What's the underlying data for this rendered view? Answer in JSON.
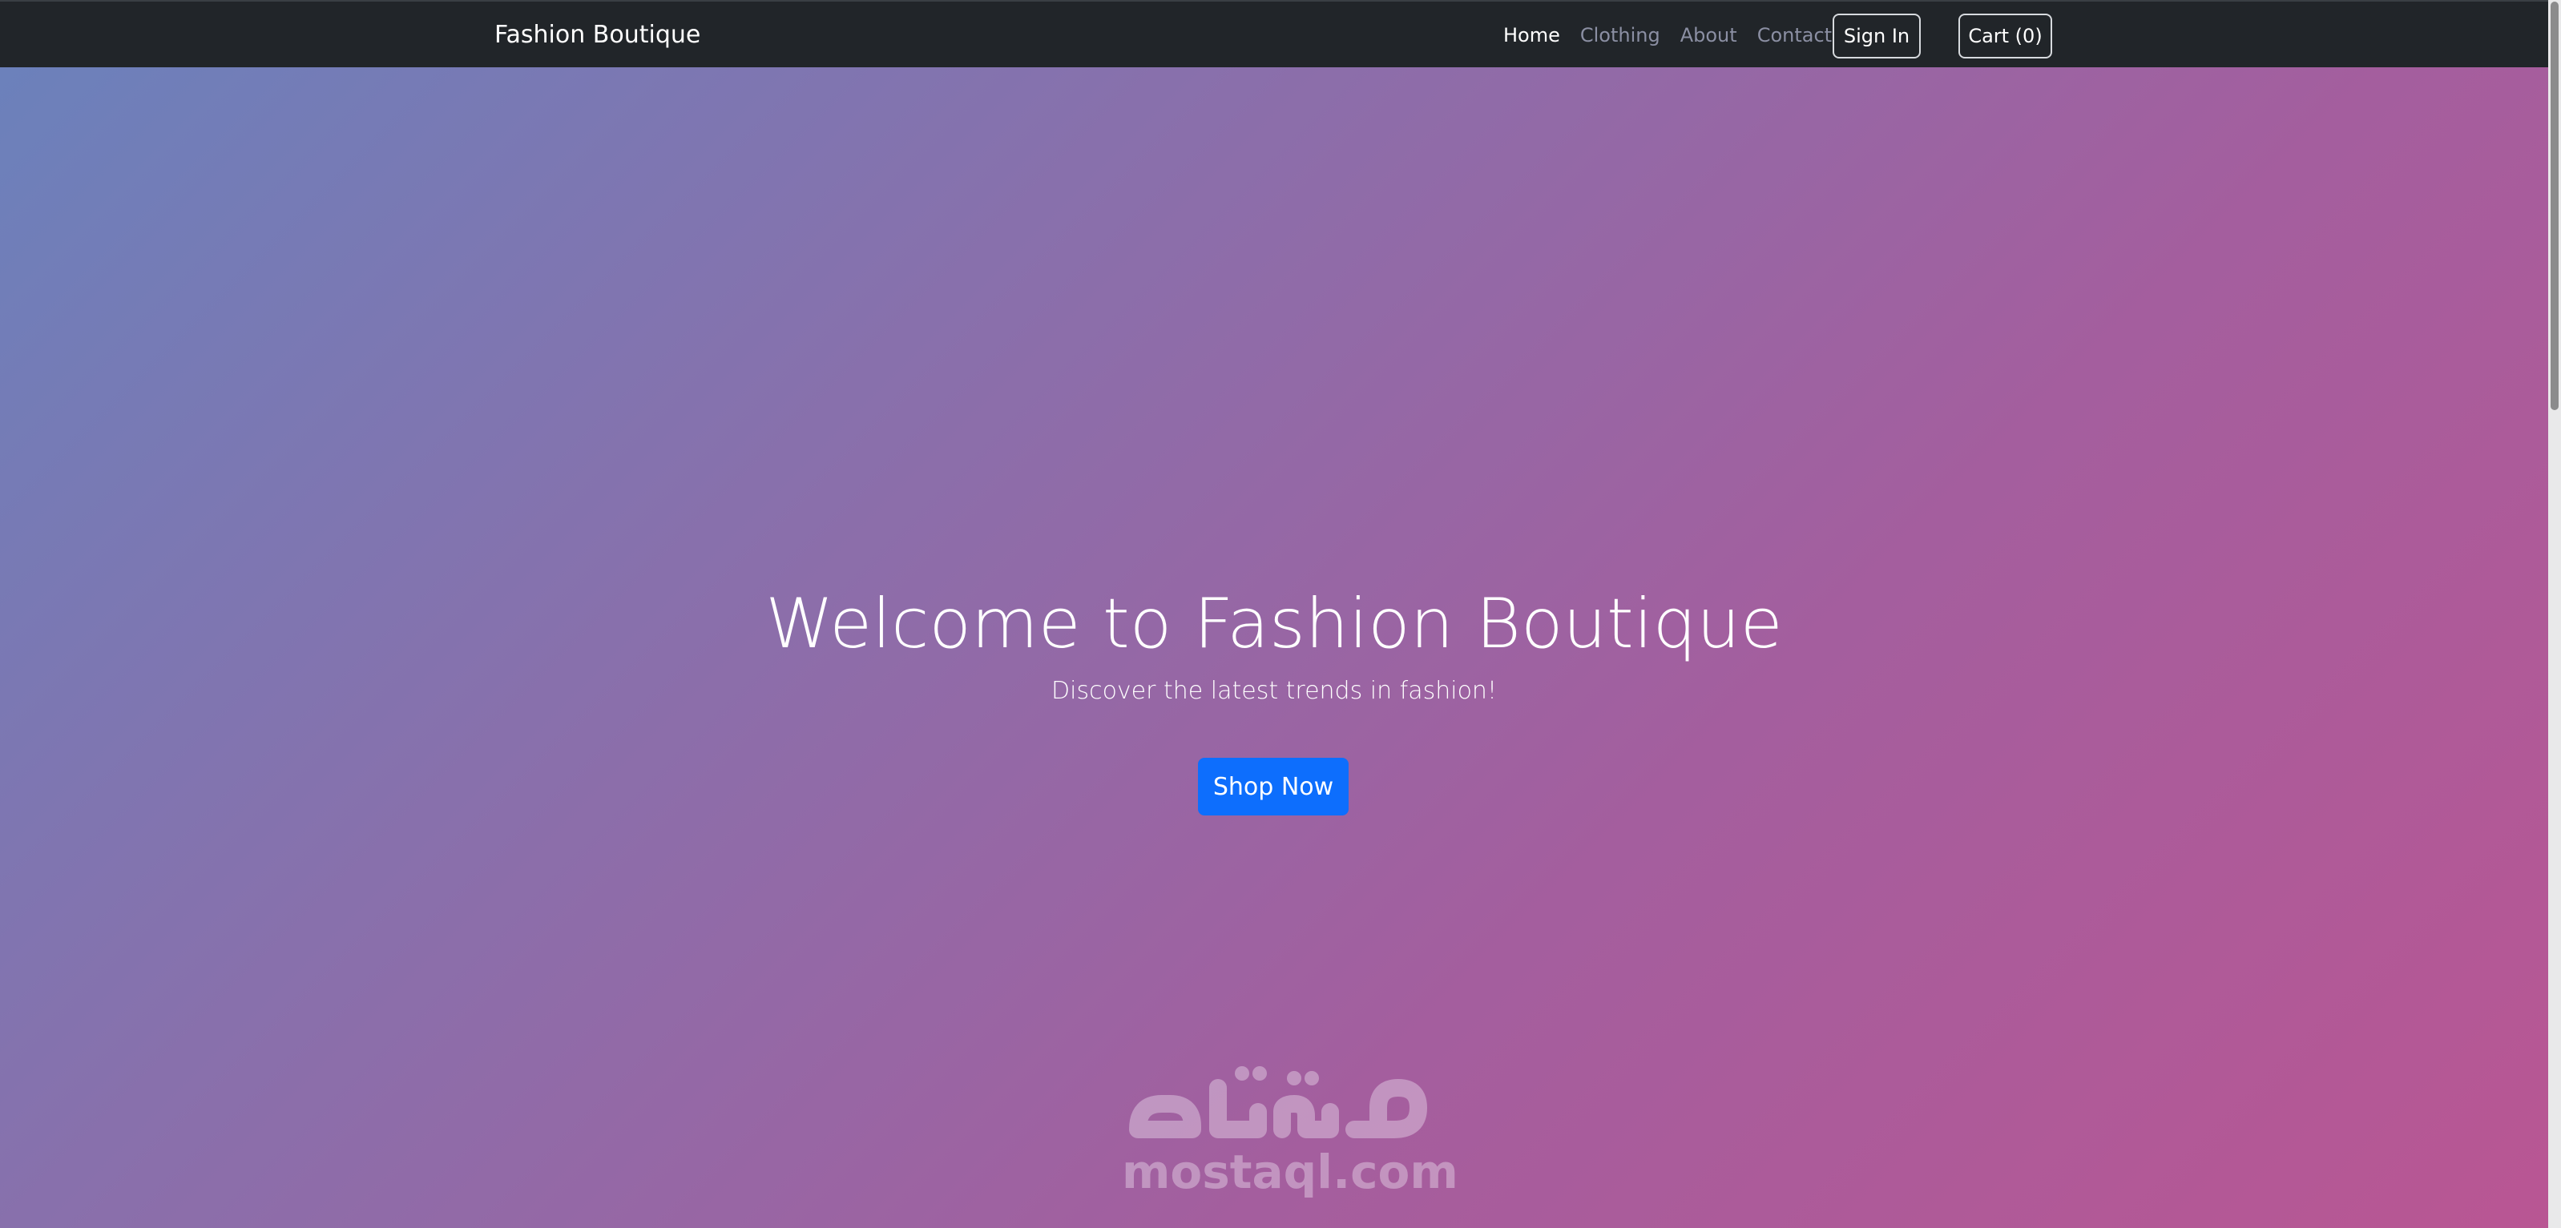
{
  "navbar": {
    "brand": "Fashion Boutique",
    "links": [
      {
        "label": "Home",
        "active": true
      },
      {
        "label": "Clothing",
        "active": false
      },
      {
        "label": "About",
        "active": false
      },
      {
        "label": "Contact",
        "active": false
      }
    ],
    "signin_label": "Sign In",
    "cart_label": "Cart (0)"
  },
  "hero": {
    "title": "Welcome to Fashion Boutique",
    "subtitle": "Discover the latest trends in fashion!",
    "cta_label": "Shop Now"
  },
  "watermark": {
    "text": "mostaql.com"
  },
  "colors": {
    "navbar_bg": "#212529",
    "primary": "#0d6efd",
    "gradient_start": "#6a82bc",
    "gradient_end": "#b95693"
  }
}
